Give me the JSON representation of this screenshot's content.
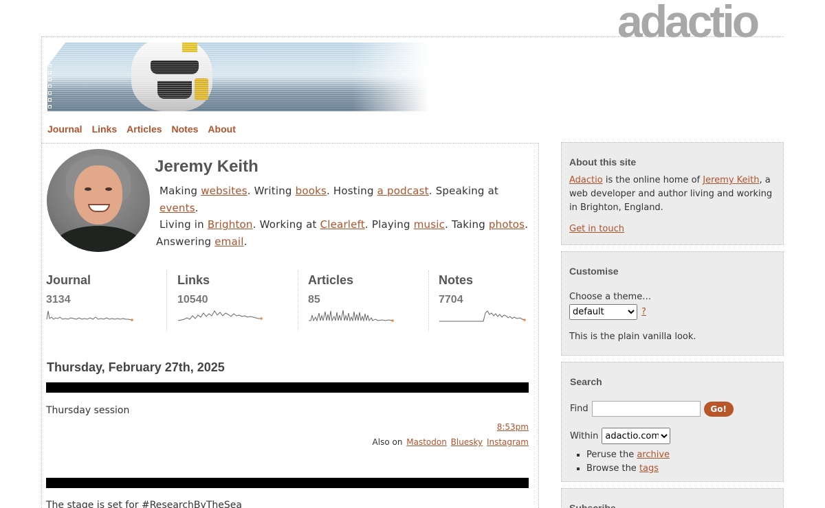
{
  "logo_text": "adactio",
  "nav": [
    "Journal",
    "Links",
    "Articles",
    "Notes",
    "About"
  ],
  "profile": {
    "name": "Jeremy Keith",
    "bio": {
      "making": "Making ",
      "websites": "websites",
      "writing": ". Writing ",
      "books": "books",
      "hosting": ". Hosting ",
      "podcast": "a podcast",
      "speaking": ". Speaking at ",
      "events": "events",
      "end1": ".",
      "living": "Living in ",
      "brighton": "Brighton",
      "working": ". Working at ",
      "clearleft": "Clearleft",
      "playing": ". Playing ",
      "music": "music",
      "taking": ". Taking ",
      "photos": "photos",
      "end2": ".",
      "answering": "Answering ",
      "email": "email",
      "end3": "."
    }
  },
  "stats": [
    {
      "label": "Journal",
      "count": "3134"
    },
    {
      "label": "Links",
      "count": "10540"
    },
    {
      "label": "Articles",
      "count": "85"
    },
    {
      "label": "Notes",
      "count": "7704"
    }
  ],
  "date_heading": "Thursday, February 27th, 2025",
  "entries": [
    {
      "text": "Thursday session",
      "time": "8:53pm",
      "also_label": "Also on",
      "also_links": [
        "Mastodon",
        "Bluesky",
        "Instagram"
      ]
    },
    {
      "text": "The stage is set for #ResearchByTheSea"
    }
  ],
  "sidebar": {
    "about": {
      "title": "About this site",
      "adactio": "Adactio",
      "text1": " is the online home of ",
      "jeremy": "Jeremy Keith",
      "text2": ", a web developer and author living and working in Brighton, England.",
      "contact": "Get in touch"
    },
    "customise": {
      "title": "Customise",
      "choose": "Choose a theme…",
      "theme_value": "default",
      "help": "?",
      "description": "This is the plain vanilla look."
    },
    "search": {
      "title": "Search",
      "find": "Find",
      "go": "Go!",
      "within": "Within",
      "within_value": "adactio.com",
      "peruse": "Peruse the ",
      "archive": "archive",
      "browse": "Browse the ",
      "tags": "tags"
    },
    "subscribe": {
      "title": "Subscribe"
    }
  },
  "colors": {
    "link": "#b0522a",
    "go_button": "#b8562a",
    "sidebar_bg": "#ececec",
    "logo": "#a8a8a8"
  }
}
